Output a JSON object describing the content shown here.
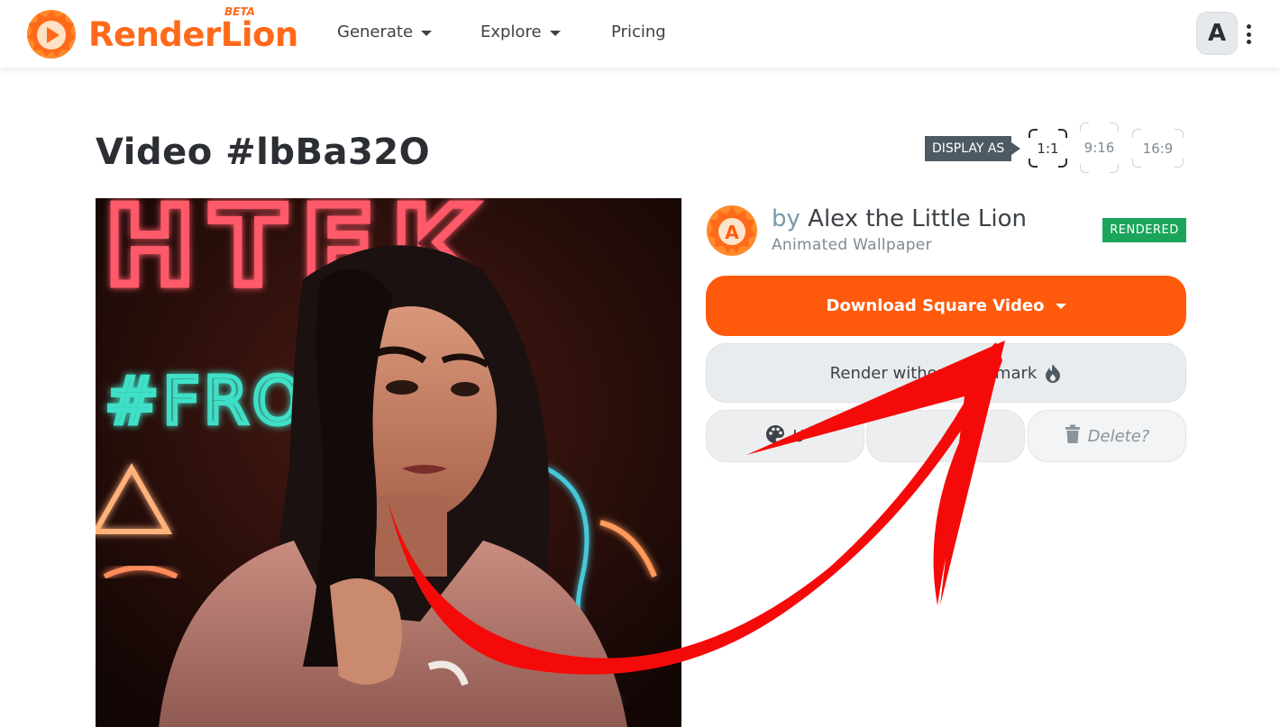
{
  "brand": {
    "name": "RenderLion",
    "badge": "BETA",
    "colors": {
      "primary": "#ff5a0c",
      "logo": "#ff6a1a",
      "success": "#1aa55a",
      "annotation": "#f50a0a"
    }
  },
  "nav": {
    "items": [
      {
        "label": "Generate",
        "has_dropdown": true
      },
      {
        "label": "Explore",
        "has_dropdown": true
      },
      {
        "label": "Pricing",
        "has_dropdown": false
      }
    ],
    "avatar_initial": "A",
    "menu_icon": "more-vertical-icon"
  },
  "page": {
    "title": "Video #lbBa32O",
    "display_as_label": "DISPLAY AS",
    "ratios": [
      {
        "label": "1:1",
        "active": true
      },
      {
        "label": "9:16",
        "active": false
      },
      {
        "label": "16:9",
        "active": false
      }
    ]
  },
  "preview": {
    "neon_top": "HTEK",
    "neon_middle": "#FRO    WOR"
  },
  "author": {
    "prefix": "by",
    "name": "Alex the Little Lion",
    "subtitle": "Animated Wallpaper",
    "avatar_initial": "A",
    "status": "RENDERED"
  },
  "actions": {
    "download_label": "Download Square Video",
    "render_label": "Render without        mark",
    "render_icon": "flame-icon",
    "small_buttons": [
      {
        "label": "U",
        "icon": "palette-icon"
      },
      {
        "label": "it",
        "icon": ""
      },
      {
        "label": "Delete?",
        "icon": "trash-icon"
      }
    ]
  }
}
